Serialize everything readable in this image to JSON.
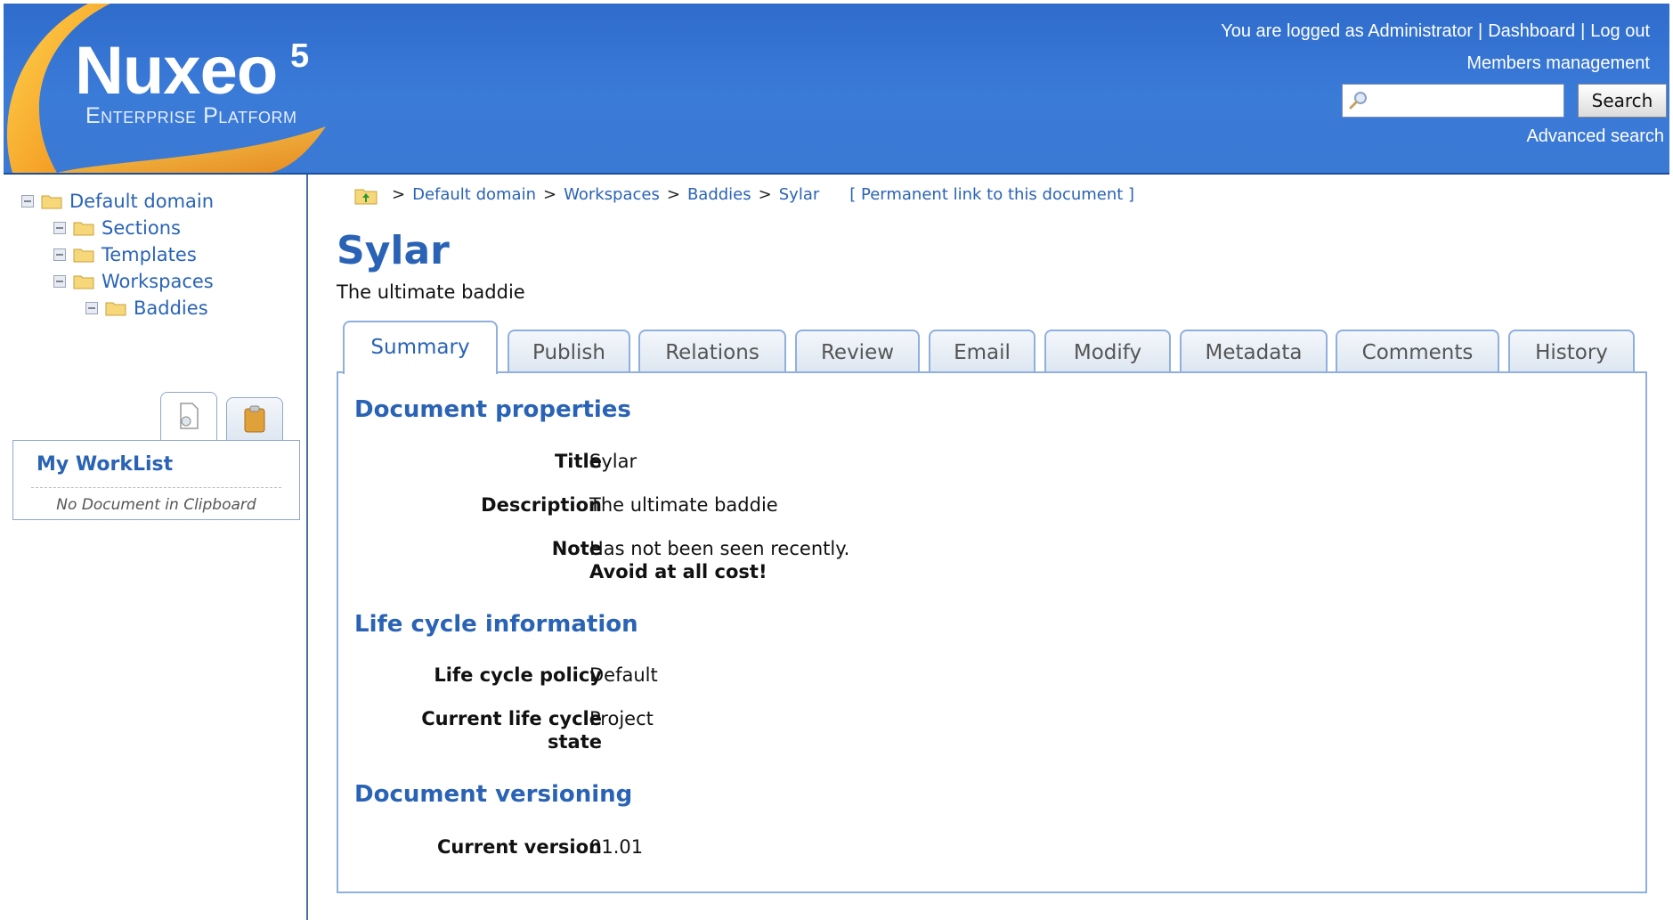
{
  "header": {
    "logo_title": "Nuxeo",
    "logo_sup": "5",
    "logo_subtitle": "Enterprise Platform",
    "logged_as": "You are logged as Administrator",
    "dashboard": "Dashboard",
    "logout": "Log out",
    "members": "Members management",
    "search_value": "",
    "search_button": "Search",
    "advanced_search": "Advanced search"
  },
  "sidebar": {
    "tree": [
      {
        "label": "Default domain"
      },
      {
        "label": "Sections"
      },
      {
        "label": "Templates"
      },
      {
        "label": "Workspaces"
      },
      {
        "label": "Baddies"
      }
    ],
    "worklist_title": "My WorkList",
    "worklist_empty": "No Document in Clipboard"
  },
  "breadcrumb": {
    "items": [
      "Default domain",
      "Workspaces",
      "Baddies",
      "Sylar"
    ],
    "separator": ">",
    "permalink": "[ Permanent link to this document ]"
  },
  "document": {
    "title": "Sylar",
    "description": "The ultimate baddie"
  },
  "tabs": [
    "Summary",
    "Publish",
    "Relations",
    "Review",
    "Email",
    "Modify",
    "Metadata",
    "Comments",
    "History"
  ],
  "active_tab": "Summary",
  "summary": {
    "properties_title": "Document properties",
    "title_label": "Title",
    "title_value": "Sylar",
    "description_label": "Description",
    "description_value": "The ultimate baddie",
    "note_label": "Note",
    "note_line1": "Has not been seen recently.",
    "note_line2": "Avoid at all cost!",
    "lifecycle_title": "Life cycle information",
    "policy_label": "Life cycle policy",
    "policy_value": "Default",
    "state_label_1": "Current life cycle",
    "state_label_2": "state",
    "state_value": "Project",
    "versioning_title": "Document versioning",
    "version_label": "Current version",
    "version_value": "01.01"
  },
  "colors": {
    "header_blue": "#3b7bd8",
    "link_blue": "#2a63b5",
    "tab_border": "#8fb0de",
    "logo_orange": "#f5a623"
  }
}
